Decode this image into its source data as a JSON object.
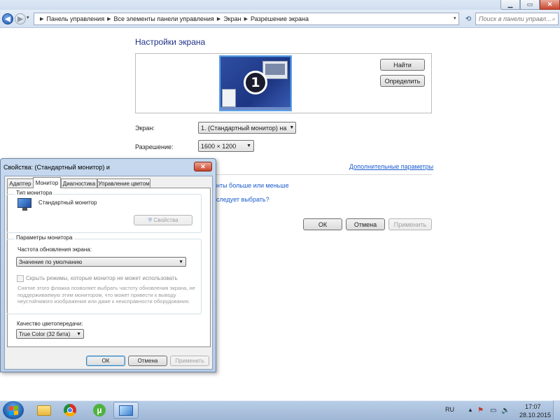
{
  "window": {
    "minimize_icon": "minimize-icon",
    "maximize_icon": "maximize-icon",
    "close_icon": "close-icon",
    "min_glyph": "▁",
    "max_glyph": "▭",
    "close_glyph": "✕"
  },
  "nav": {
    "back_glyph": "◀",
    "forward_glyph": "▶",
    "history_glyph": "▾",
    "breadcrumb": [
      "Панель управления",
      "Все элементы панели управления",
      "Экран",
      "Разрешение экрана"
    ],
    "crumb_sep": "▶",
    "search_placeholder": "Поиск в панели управл...",
    "search_glyph": "⌕",
    "refresh_glyph": "⟲"
  },
  "main": {
    "title": "Настройки экрана",
    "monitor_number": "1",
    "find_label": "Найти",
    "identify_label": "Определить",
    "screen_label": "Экран:",
    "screen_value": "1. (Стандартный монитор) на",
    "resolution_label": "Разрешение:",
    "resolution_value": "1600 × 1200",
    "advanced_link": "Дополнительные параметры",
    "size_link_partial": "нты больше или меньше",
    "choose_link_partial": "следует выбрать?",
    "ok_label": "ОК",
    "cancel_label": "Отмена",
    "apply_label": "Применить",
    "combo_arrow": "▼"
  },
  "dialog": {
    "title": "Свойства: (Стандартный монитор) и",
    "close_glyph": "✕",
    "tabs": [
      "Адаптер",
      "Монитор",
      "Диагностика",
      "Управление цветом"
    ],
    "active_tab": "Монитор",
    "type_group_title": "Тип монитора",
    "monitor_name": "Стандартный монитор",
    "properties_label": "Свойства",
    "shield_glyph": "⛨",
    "params_group_title": "Параметры монитора",
    "refresh_label": "Частота обновления экрана:",
    "refresh_value": "Значение по умолчанию",
    "hide_modes_label": "Скрыть режимы, которые монитор не может использовать",
    "hide_modes_checked": false,
    "hide_modes_desc": "Снятие этого флажка позволяет выбрать частоту обновления экрана, не поддерживаемую этим монитором, что может привести к выводу неустойчивого изображения или даже к неисправности оборудования.",
    "color_label": "Качество цветопередачи:",
    "color_value": "True Color (32 бита)",
    "ok_label": "ОК",
    "cancel_label": "Отмена",
    "apply_label": "Применить"
  },
  "taskbar": {
    "apps": [
      "start-orb",
      "windows-explorer",
      "google-chrome",
      "utorrent",
      "display-settings"
    ],
    "utorrent_glyph": "µ",
    "language": "RU",
    "tray_arrow": "▲",
    "tray_flag": "⚑",
    "tray_network": "▭",
    "tray_volume": "🔈",
    "time": "17:07",
    "date": "28.10.2015"
  },
  "colors": {
    "title_blue": "#1e3287",
    "link_blue": "#1a5ccf",
    "close_red": "#c9442b",
    "taskbar": "#a9c0de"
  }
}
